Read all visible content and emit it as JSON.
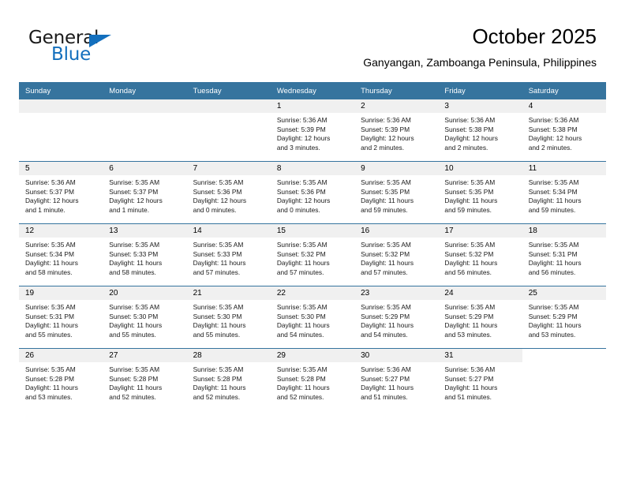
{
  "brand": {
    "name_part1": "General",
    "name_part2": "Blue"
  },
  "header": {
    "title": "October 2025",
    "location": "Ganyangan, Zamboanga Peninsula, Philippines"
  },
  "colors": {
    "header_blue": "#36749e",
    "brand_blue": "#136fbd",
    "daynum_band": "#f0f0f0"
  },
  "calendar": {
    "weekday_headers": [
      "Sunday",
      "Monday",
      "Tuesday",
      "Wednesday",
      "Thursday",
      "Friday",
      "Saturday"
    ],
    "weeks": [
      [
        {
          "day": "",
          "lines": [
            "",
            "",
            "",
            ""
          ],
          "empty": true
        },
        {
          "day": "",
          "lines": [
            "",
            "",
            "",
            ""
          ],
          "empty": true
        },
        {
          "day": "",
          "lines": [
            "",
            "",
            "",
            ""
          ],
          "empty": true
        },
        {
          "day": "1",
          "lines": [
            "Sunrise: 5:36 AM",
            "Sunset: 5:39 PM",
            "Daylight: 12 hours",
            "and 3 minutes."
          ]
        },
        {
          "day": "2",
          "lines": [
            "Sunrise: 5:36 AM",
            "Sunset: 5:39 PM",
            "Daylight: 12 hours",
            "and 2 minutes."
          ]
        },
        {
          "day": "3",
          "lines": [
            "Sunrise: 5:36 AM",
            "Sunset: 5:38 PM",
            "Daylight: 12 hours",
            "and 2 minutes."
          ]
        },
        {
          "day": "4",
          "lines": [
            "Sunrise: 5:36 AM",
            "Sunset: 5:38 PM",
            "Daylight: 12 hours",
            "and 2 minutes."
          ]
        }
      ],
      [
        {
          "day": "5",
          "lines": [
            "Sunrise: 5:36 AM",
            "Sunset: 5:37 PM",
            "Daylight: 12 hours",
            "and 1 minute."
          ]
        },
        {
          "day": "6",
          "lines": [
            "Sunrise: 5:35 AM",
            "Sunset: 5:37 PM",
            "Daylight: 12 hours",
            "and 1 minute."
          ]
        },
        {
          "day": "7",
          "lines": [
            "Sunrise: 5:35 AM",
            "Sunset: 5:36 PM",
            "Daylight: 12 hours",
            "and 0 minutes."
          ]
        },
        {
          "day": "8",
          "lines": [
            "Sunrise: 5:35 AM",
            "Sunset: 5:36 PM",
            "Daylight: 12 hours",
            "and 0 minutes."
          ]
        },
        {
          "day": "9",
          "lines": [
            "Sunrise: 5:35 AM",
            "Sunset: 5:35 PM",
            "Daylight: 11 hours",
            "and 59 minutes."
          ]
        },
        {
          "day": "10",
          "lines": [
            "Sunrise: 5:35 AM",
            "Sunset: 5:35 PM",
            "Daylight: 11 hours",
            "and 59 minutes."
          ]
        },
        {
          "day": "11",
          "lines": [
            "Sunrise: 5:35 AM",
            "Sunset: 5:34 PM",
            "Daylight: 11 hours",
            "and 59 minutes."
          ]
        }
      ],
      [
        {
          "day": "12",
          "lines": [
            "Sunrise: 5:35 AM",
            "Sunset: 5:34 PM",
            "Daylight: 11 hours",
            "and 58 minutes."
          ]
        },
        {
          "day": "13",
          "lines": [
            "Sunrise: 5:35 AM",
            "Sunset: 5:33 PM",
            "Daylight: 11 hours",
            "and 58 minutes."
          ]
        },
        {
          "day": "14",
          "lines": [
            "Sunrise: 5:35 AM",
            "Sunset: 5:33 PM",
            "Daylight: 11 hours",
            "and 57 minutes."
          ]
        },
        {
          "day": "15",
          "lines": [
            "Sunrise: 5:35 AM",
            "Sunset: 5:32 PM",
            "Daylight: 11 hours",
            "and 57 minutes."
          ]
        },
        {
          "day": "16",
          "lines": [
            "Sunrise: 5:35 AM",
            "Sunset: 5:32 PM",
            "Daylight: 11 hours",
            "and 57 minutes."
          ]
        },
        {
          "day": "17",
          "lines": [
            "Sunrise: 5:35 AM",
            "Sunset: 5:32 PM",
            "Daylight: 11 hours",
            "and 56 minutes."
          ]
        },
        {
          "day": "18",
          "lines": [
            "Sunrise: 5:35 AM",
            "Sunset: 5:31 PM",
            "Daylight: 11 hours",
            "and 56 minutes."
          ]
        }
      ],
      [
        {
          "day": "19",
          "lines": [
            "Sunrise: 5:35 AM",
            "Sunset: 5:31 PM",
            "Daylight: 11 hours",
            "and 55 minutes."
          ]
        },
        {
          "day": "20",
          "lines": [
            "Sunrise: 5:35 AM",
            "Sunset: 5:30 PM",
            "Daylight: 11 hours",
            "and 55 minutes."
          ]
        },
        {
          "day": "21",
          "lines": [
            "Sunrise: 5:35 AM",
            "Sunset: 5:30 PM",
            "Daylight: 11 hours",
            "and 55 minutes."
          ]
        },
        {
          "day": "22",
          "lines": [
            "Sunrise: 5:35 AM",
            "Sunset: 5:30 PM",
            "Daylight: 11 hours",
            "and 54 minutes."
          ]
        },
        {
          "day": "23",
          "lines": [
            "Sunrise: 5:35 AM",
            "Sunset: 5:29 PM",
            "Daylight: 11 hours",
            "and 54 minutes."
          ]
        },
        {
          "day": "24",
          "lines": [
            "Sunrise: 5:35 AM",
            "Sunset: 5:29 PM",
            "Daylight: 11 hours",
            "and 53 minutes."
          ]
        },
        {
          "day": "25",
          "lines": [
            "Sunrise: 5:35 AM",
            "Sunset: 5:29 PM",
            "Daylight: 11 hours",
            "and 53 minutes."
          ]
        }
      ],
      [
        {
          "day": "26",
          "lines": [
            "Sunrise: 5:35 AM",
            "Sunset: 5:28 PM",
            "Daylight: 11 hours",
            "and 53 minutes."
          ]
        },
        {
          "day": "27",
          "lines": [
            "Sunrise: 5:35 AM",
            "Sunset: 5:28 PM",
            "Daylight: 11 hours",
            "and 52 minutes."
          ]
        },
        {
          "day": "28",
          "lines": [
            "Sunrise: 5:35 AM",
            "Sunset: 5:28 PM",
            "Daylight: 11 hours",
            "and 52 minutes."
          ]
        },
        {
          "day": "29",
          "lines": [
            "Sunrise: 5:35 AM",
            "Sunset: 5:28 PM",
            "Daylight: 11 hours",
            "and 52 minutes."
          ]
        },
        {
          "day": "30",
          "lines": [
            "Sunrise: 5:36 AM",
            "Sunset: 5:27 PM",
            "Daylight: 11 hours",
            "and 51 minutes."
          ]
        },
        {
          "day": "31",
          "lines": [
            "Sunrise: 5:36 AM",
            "Sunset: 5:27 PM",
            "Daylight: 11 hours",
            "and 51 minutes."
          ]
        },
        {
          "day": "",
          "lines": [
            "",
            "",
            "",
            ""
          ],
          "blank": true
        }
      ]
    ]
  }
}
